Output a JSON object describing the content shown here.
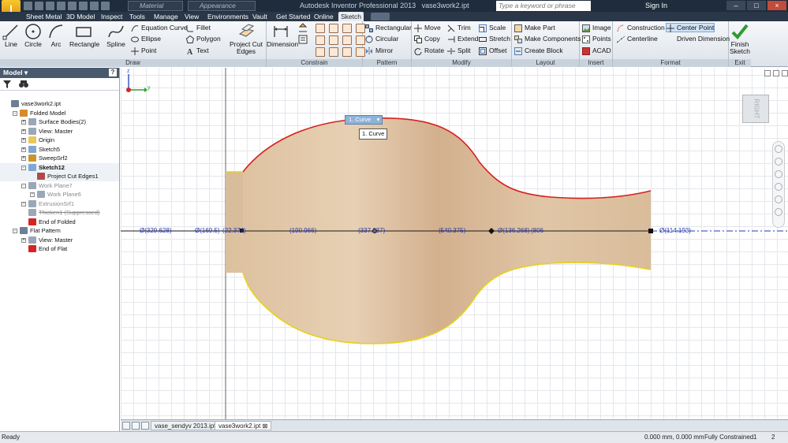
{
  "title_bar": {
    "app_title": "Autodesk Inventor Professional 2013",
    "doc_name": "vase3work2.ipt",
    "material": "Material",
    "appearance": "Appearance",
    "search_placeholder": "Type a keyword or phrase",
    "sign_in": "Sign In",
    "logo_text": "I",
    "logo_sub": "PRO"
  },
  "menu_tabs": [
    "Sheet Metal",
    "3D Model",
    "Inspect",
    "Tools",
    "Manage",
    "View",
    "Environments",
    "Vault",
    "Get Started",
    "Online",
    "Sketch"
  ],
  "ribbon": {
    "draw": {
      "title": "Draw",
      "line": "Line",
      "circle": "Circle",
      "arc": "Arc",
      "rectangle": "Rectangle",
      "spline": "Spline",
      "equation_curve": "Equation Curve",
      "ellipse": "Ellipse",
      "point": "Point",
      "fillet": "Fillet",
      "polygon": "Polygon",
      "text": "Text",
      "project_cut_edges": "Project Cut Edges"
    },
    "constrain": {
      "title": "Constrain",
      "dimension": "Dimension"
    },
    "pattern": {
      "title": "Pattern",
      "rectangular": "Rectangular",
      "circular": "Circular",
      "mirror": "Mirror"
    },
    "modify": {
      "title": "Modify",
      "move": "Move",
      "copy": "Copy",
      "rotate": "Rotate",
      "trim": "Trim",
      "extend": "Extend",
      "split": "Split",
      "scale": "Scale",
      "stretch": "Stretch",
      "offset": "Offset"
    },
    "layout": {
      "title": "Layout",
      "make_part": "Make Part",
      "make_components": "Make Components",
      "create_block": "Create Block"
    },
    "insert": {
      "title": "Insert",
      "image": "Image",
      "points": "Points",
      "acad": "ACAD"
    },
    "format": {
      "title": "Format",
      "construction": "Construction",
      "centerline": "Centerline",
      "center_point": "Center Point",
      "driven_dimension": "Driven Dimension"
    },
    "exit": {
      "title": "Exit",
      "finish_sketch": "Finish Sketch"
    }
  },
  "browser": {
    "title": "Model",
    "help": "?",
    "tree": [
      {
        "label": "vase3work2.ipt",
        "indent": 0,
        "pm": "",
        "style": ""
      },
      {
        "label": "Folded Model",
        "indent": 1,
        "pm": "-",
        "style": ""
      },
      {
        "label": "Surface Bodies(2)",
        "indent": 2,
        "pm": "+",
        "style": ""
      },
      {
        "label": "View: Master",
        "indent": 2,
        "pm": "+",
        "style": ""
      },
      {
        "label": "Origin",
        "indent": 2,
        "pm": "+",
        "style": ""
      },
      {
        "label": "Sketch5",
        "indent": 2,
        "pm": "+",
        "style": ""
      },
      {
        "label": "SweepSrf2",
        "indent": 2,
        "pm": "+",
        "style": ""
      },
      {
        "label": "Sketch12",
        "indent": 2,
        "pm": "-",
        "style": "bold"
      },
      {
        "label": "Project Cut Edges1",
        "indent": 3,
        "pm": "",
        "style": ""
      },
      {
        "label": "Work Plane7",
        "indent": 2,
        "pm": "-",
        "style": "dim"
      },
      {
        "label": "Work Plane6",
        "indent": 3,
        "pm": "+",
        "style": "dim"
      },
      {
        "label": "ExtrusionSrf1",
        "indent": 2,
        "pm": "+",
        "style": "dim"
      },
      {
        "label": "Thicken1 (Suppressed)",
        "indent": 2,
        "pm": "",
        "style": "dim strike"
      },
      {
        "label": "End of Folded",
        "indent": 2,
        "pm": "",
        "style": ""
      },
      {
        "label": "Flat Pattern",
        "indent": 1,
        "pm": "-",
        "style": ""
      },
      {
        "label": "View: Master",
        "indent": 2,
        "pm": "+",
        "style": ""
      },
      {
        "label": "End of Flat",
        "indent": 2,
        "pm": "",
        "style": ""
      }
    ]
  },
  "canvas": {
    "dimensions": [
      "Ø(329.628)",
      "Ø(169.5)",
      "(22.374)",
      "(190.966)",
      "(337.637)",
      "(540.375)",
      "Ø(136.268)",
      "(806",
      "Ø(114.193)"
    ],
    "tooltip_primary": "1. Curve",
    "tooltip_secondary": "1. Curve",
    "viewcube_face": "RIGHT",
    "triad_z": "z",
    "triad_y": "y"
  },
  "doc_tabs": [
    "vase_sendyv 2013.ipt",
    "vase3work2.ipt"
  ],
  "status": {
    "left": "Ready",
    "coords": "0.000 mm, 0.000 mm",
    "constraint": "Fully Constrained",
    "n1": "1",
    "n2": "2"
  }
}
